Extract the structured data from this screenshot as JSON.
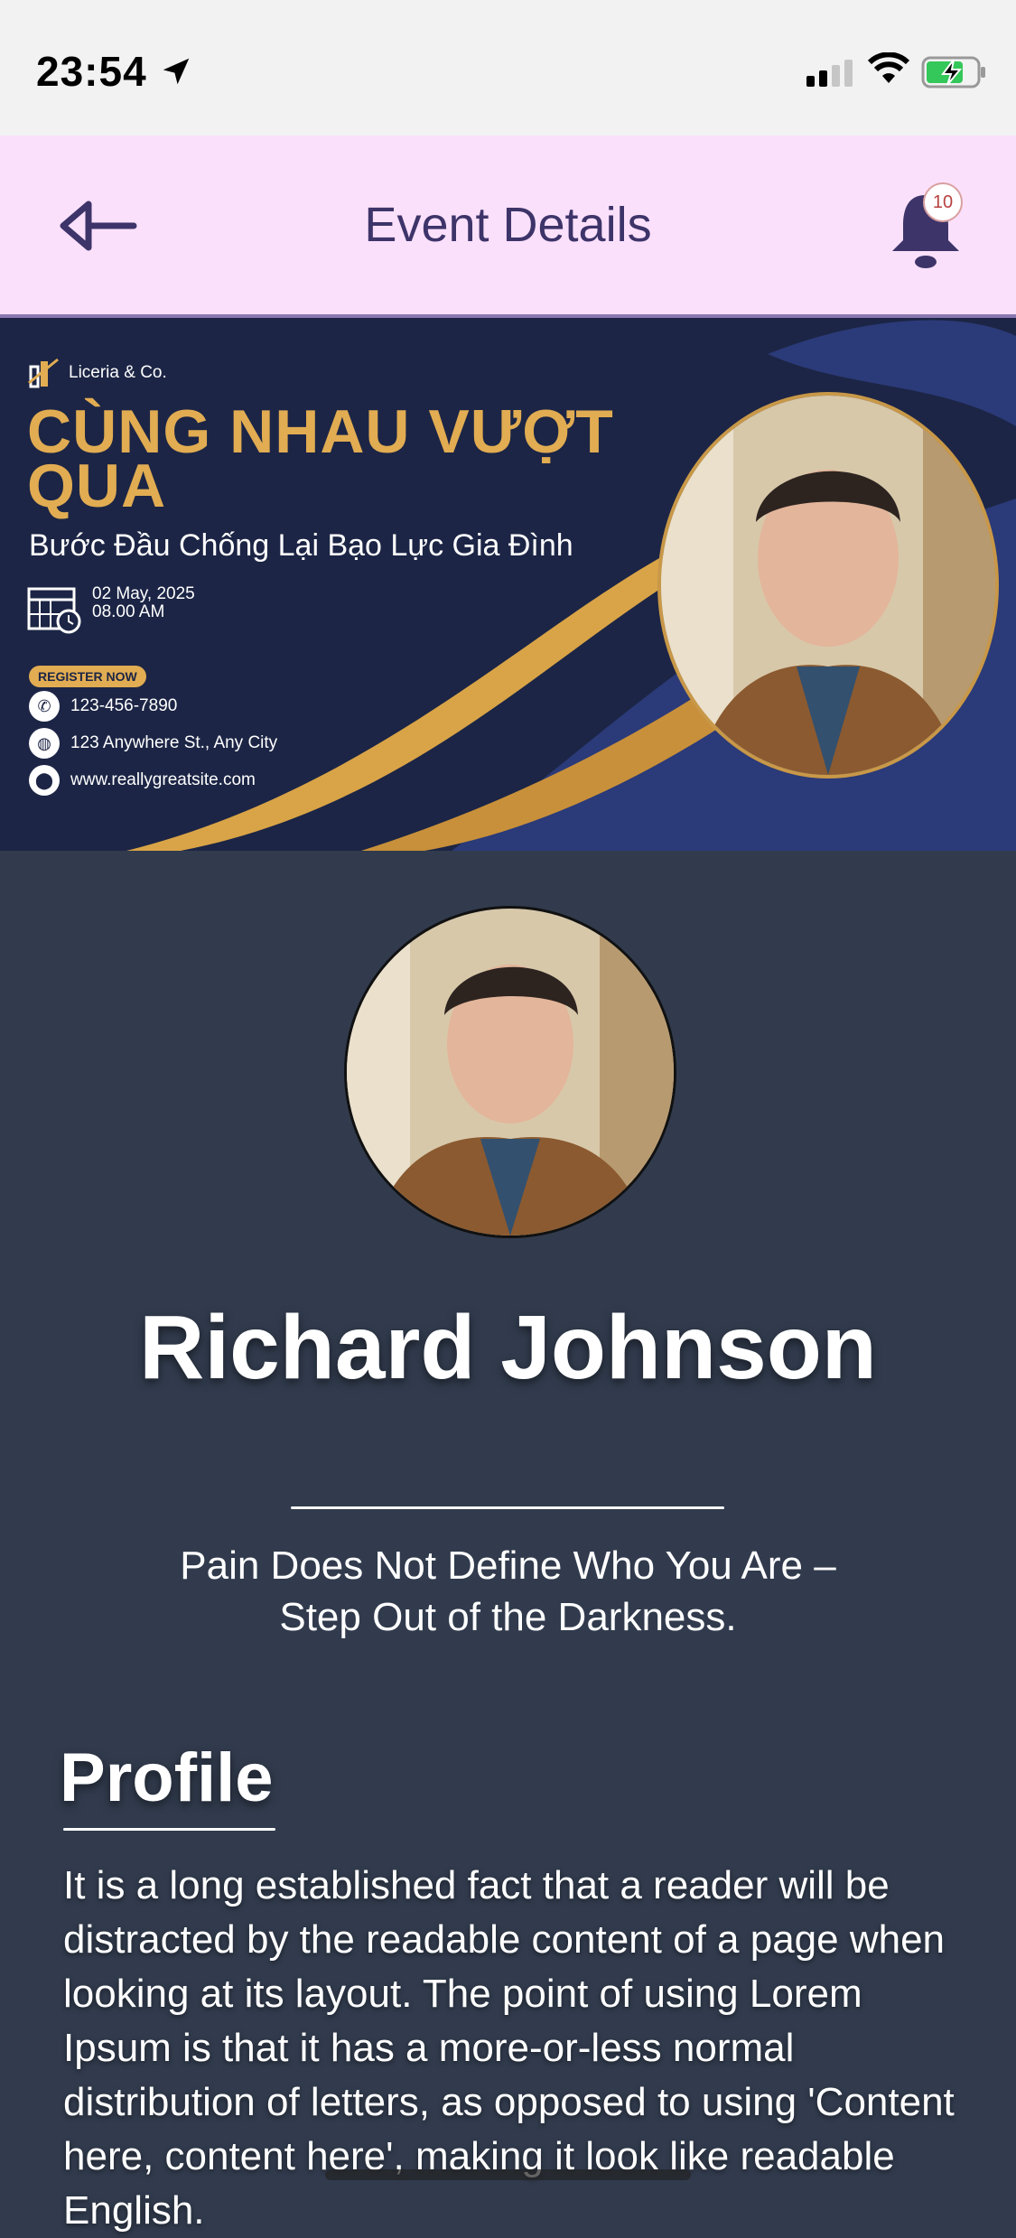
{
  "status": {
    "time": "23:54"
  },
  "header": {
    "title": "Event Details",
    "notification_count": "10"
  },
  "banner": {
    "brand": "Liceria & Co.",
    "title": "CÙNG NHAU VƯỢT QUA",
    "subtitle": "Bước Đầu Chống Lại Bạo Lực Gia Đình",
    "date": "02 May, 2025",
    "time": "08.00 AM",
    "register": "REGISTER NOW",
    "phone": "123-456-7890",
    "address": "123 Anywhere St., Any City",
    "website": "www.reallygreatsite.com"
  },
  "speaker": {
    "name": "Richard Johnson",
    "tagline": "Pain Does Not Define Who You Are – Step Out of the Darkness."
  },
  "profile": {
    "heading": "Profile",
    "text": "It is a long established fact that a reader will be distracted by the readable content of a page when looking at its layout. The point of using Lorem Ipsum is that it has a more-or-less normal distribution of letters, as opposed to using 'Content here, content here', making it look like readable English."
  },
  "colors": {
    "header_bg": "#fbe0fb",
    "accent": "#3d3469",
    "banner_gold": "#e1ac52",
    "page_bg": "#313b4d"
  }
}
